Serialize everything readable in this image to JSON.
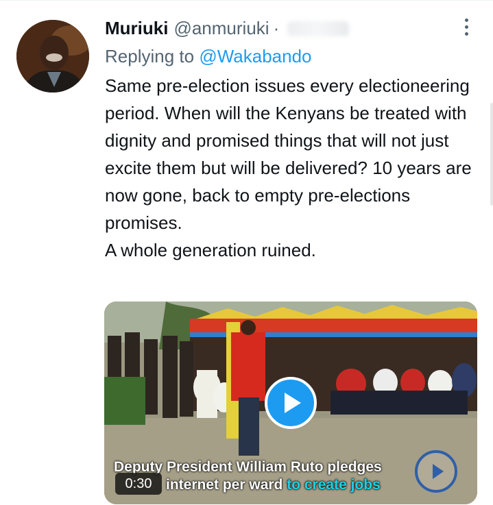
{
  "tweet": {
    "display_name": "Muriuki",
    "handle": "@anmuriuki",
    "separator": "·",
    "reply_prefix": "Replying to",
    "reply_to": "@Wakabando",
    "text_lines": [
      "Same pre-election issues every electioneering period. When will the Kenyans be treated with dignity and promised things that will not just excite them but will be delivered? 10 years are now gone, back to empty pre-elections promises.",
      "A whole generation ruined."
    ]
  },
  "video": {
    "duration": "0:30",
    "caption_line1": "Deputy President William Ruto pledges",
    "caption_line2_white": "internet per ward",
    "caption_line2_cyan": "to create jobs"
  },
  "icons": {
    "more": "more-vertical-icon",
    "play": "play-icon",
    "logo": "channel-logo-icon"
  },
  "colors": {
    "accent": "#1d9bf0",
    "text": "#0f1419",
    "secondary": "#536471",
    "caption_highlight": "#19d3e6"
  }
}
